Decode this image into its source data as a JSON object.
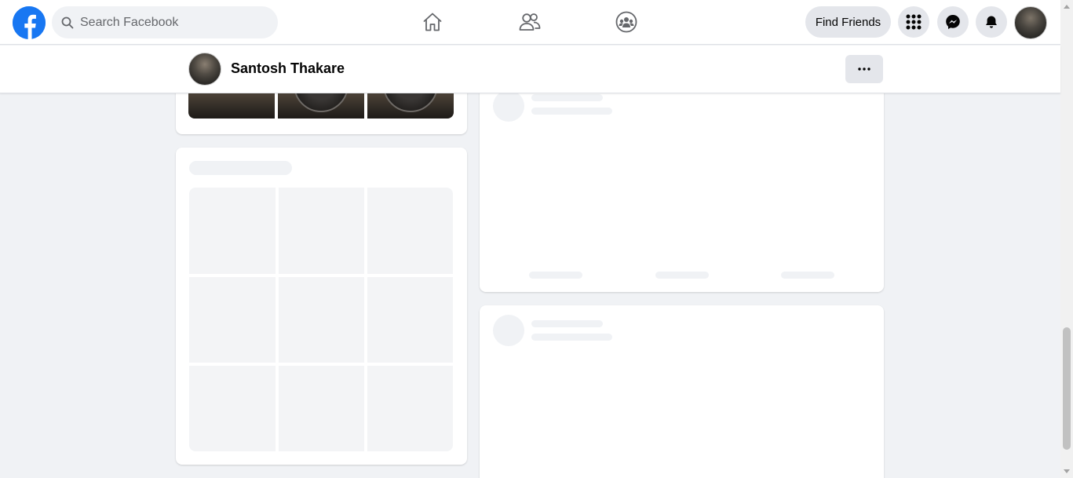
{
  "nav": {
    "search_placeholder": "Search Facebook",
    "find_friends_label": "Find Friends",
    "brand_color": "#1877f2",
    "icons": [
      "home-icon",
      "friends-icon",
      "groups-icon",
      "menu-grid-icon",
      "messenger-icon",
      "notifications-icon"
    ]
  },
  "profile": {
    "name": "Santosh Thakare"
  }
}
